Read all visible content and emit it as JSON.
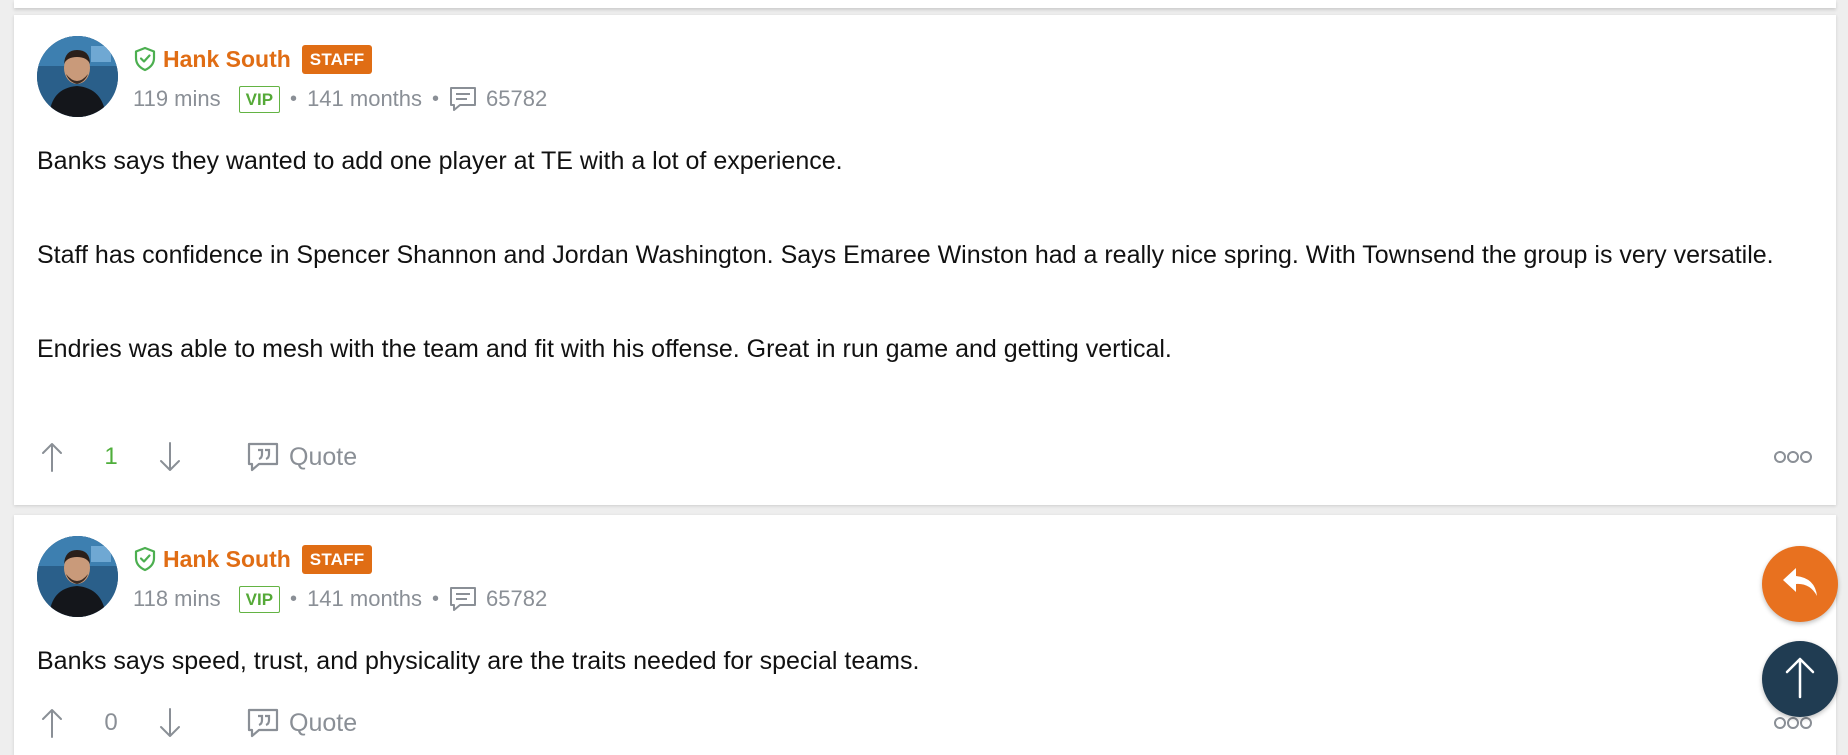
{
  "colors": {
    "accent_orange": "#e06d14",
    "vip_green": "#55a938",
    "upvote_green": "#4fae3b",
    "muted_gray": "#8a8f96",
    "fab_top_navy": "#203c52"
  },
  "posts": [
    {
      "author": "Hank South",
      "role_badge": "STAFF",
      "time_ago": "119 mins",
      "vip_label": "VIP",
      "membership": "141 months",
      "post_count": "65782",
      "paragraphs": [
        "Banks says they wanted to add one player at TE with a lot of experience.",
        "Staff has confidence in Spencer Shannon and Jordan Washington. Says Emaree Winston had a really nice spring. With Townsend the group is very versatile.",
        "Endries was able to mesh with the team and fit with his offense. Great in run game and getting vertical."
      ],
      "vote_count": "1",
      "quote_label": "Quote"
    },
    {
      "author": "Hank South",
      "role_badge": "STAFF",
      "time_ago": "118 mins",
      "vip_label": "VIP",
      "membership": "141 months",
      "post_count": "65782",
      "paragraphs": [
        "Banks says speed, trust, and physicality are the traits needed for special teams."
      ],
      "vote_count": "0",
      "quote_label": "Quote"
    }
  ],
  "icons": {
    "verified": "shield-check-icon",
    "posts": "comment-icon",
    "upvote": "arrow-up-icon",
    "downvote": "arrow-down-icon",
    "quote": "quote-icon",
    "more": "more-icon",
    "reply": "reply-icon",
    "scroll_top": "arrow-up-icon"
  }
}
